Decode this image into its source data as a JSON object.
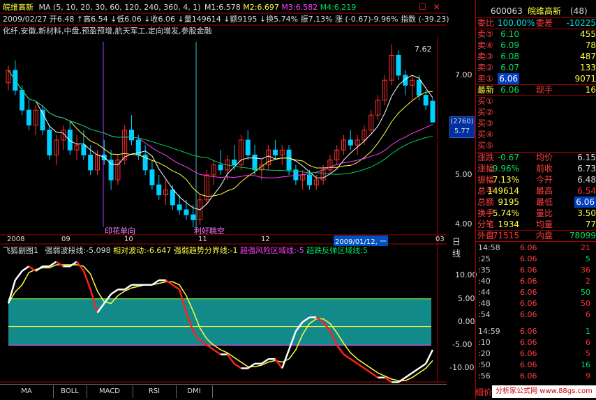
{
  "header": {
    "stock_name": "皖维高新",
    "ma_params": "MA (5, 10, 20, 30, 60, 120, 240, 360, 4, 1)",
    "m1": "M1:6.578",
    "m2": "M2:6.697",
    "m3": "M3:6.582",
    "m4": "M4:6.219",
    "close_icon": "✕",
    "restore_icon": "☐",
    "quote_line": "2009/02/27  开6.48  ↑高6.54  ↓低6.06  ↓收6.06  ↓量149614  ↓额9195  ↓换5.74%  振7.13%  涨 (-0.67)-9.96%  指数 (-39.23)",
    "concepts": "化纤,安徽,新材料,中盘,预盈预增,航天军工,定向增发,参股金融"
  },
  "price_chart": {
    "price_labels": [
      "7.00",
      "6.00",
      "5.00",
      "4.00"
    ],
    "peak_label": "7.62",
    "current_box_top": "(2760)",
    "current_box_bottom": "5.77",
    "annotation_left": "印花单向",
    "annotation_right": "利好眺空",
    "date_labels": [
      "2008",
      "09",
      "10",
      "11",
      "12",
      "2009/01/12, 一",
      "03"
    ],
    "period": "日线",
    "candles": [
      [
        6.85,
        7.2,
        6.7,
        7.1
      ],
      [
        7.1,
        7.3,
        6.6,
        6.7
      ],
      [
        6.7,
        6.8,
        6.2,
        6.3
      ],
      [
        6.3,
        6.5,
        5.9,
        6.0
      ],
      [
        6.0,
        6.4,
        5.8,
        6.3
      ],
      [
        6.3,
        6.4,
        5.8,
        5.9
      ],
      [
        5.9,
        6.0,
        5.3,
        5.4
      ],
      [
        5.4,
        5.8,
        5.2,
        5.7
      ],
      [
        5.7,
        6.0,
        5.5,
        5.9
      ],
      [
        5.9,
        6.1,
        5.4,
        5.5
      ],
      [
        5.5,
        5.8,
        5.3,
        5.6
      ],
      [
        5.6,
        5.9,
        5.3,
        5.4
      ],
      [
        5.4,
        5.6,
        5.0,
        5.1
      ],
      [
        5.1,
        5.5,
        5.0,
        5.4
      ],
      [
        5.4,
        5.7,
        5.2,
        5.3
      ],
      [
        5.3,
        5.5,
        4.7,
        4.9
      ],
      [
        4.9,
        5.4,
        4.8,
        5.3
      ],
      [
        5.3,
        6.0,
        5.2,
        5.9
      ],
      [
        5.9,
        6.2,
        5.6,
        5.7
      ],
      [
        5.7,
        5.8,
        5.3,
        5.4
      ],
      [
        5.4,
        5.6,
        5.0,
        5.1
      ],
      [
        5.1,
        5.3,
        4.7,
        4.8
      ],
      [
        4.8,
        5.0,
        4.5,
        4.6
      ],
      [
        4.6,
        4.9,
        4.4,
        4.7
      ],
      [
        4.7,
        4.8,
        4.3,
        4.4
      ],
      [
        4.4,
        4.6,
        4.2,
        4.3
      ],
      [
        4.3,
        4.5,
        4.1,
        4.2
      ],
      [
        4.2,
        4.4,
        3.95,
        4.1
      ],
      [
        4.1,
        4.6,
        4.0,
        4.5
      ],
      [
        4.5,
        5.1,
        4.4,
        5.0
      ],
      [
        5.0,
        5.3,
        4.8,
        5.2
      ],
      [
        5.2,
        5.5,
        5.0,
        5.1
      ],
      [
        5.1,
        5.4,
        4.9,
        5.3
      ],
      [
        5.3,
        5.6,
        5.1,
        5.2
      ],
      [
        5.2,
        5.8,
        5.1,
        5.7
      ],
      [
        5.7,
        5.9,
        5.3,
        5.4
      ],
      [
        5.4,
        5.6,
        5.0,
        5.1
      ],
      [
        5.1,
        5.3,
        4.9,
        5.2
      ],
      [
        5.2,
        5.6,
        5.1,
        5.5
      ],
      [
        5.5,
        5.7,
        5.3,
        5.4
      ],
      [
        5.4,
        5.6,
        5.2,
        5.5
      ],
      [
        5.5,
        5.6,
        5.0,
        5.1
      ],
      [
        5.1,
        5.2,
        4.8,
        4.9
      ],
      [
        4.9,
        5.1,
        4.7,
        5.0
      ],
      [
        5.0,
        5.1,
        4.7,
        4.8
      ],
      [
        4.8,
        5.0,
        4.7,
        4.9
      ],
      [
        4.9,
        5.2,
        4.8,
        5.1
      ],
      [
        5.1,
        5.4,
        5.0,
        5.3
      ],
      [
        5.3,
        5.6,
        5.2,
        5.5
      ],
      [
        5.5,
        5.8,
        5.4,
        5.7
      ],
      [
        5.7,
        5.9,
        5.5,
        5.6
      ],
      [
        5.6,
        5.8,
        5.4,
        5.7
      ],
      [
        5.7,
        6.0,
        5.6,
        5.9
      ],
      [
        5.9,
        6.3,
        5.8,
        6.2
      ],
      [
        6.2,
        6.6,
        6.1,
        6.5
      ],
      [
        6.5,
        7.0,
        6.4,
        6.9
      ],
      [
        6.9,
        7.62,
        6.8,
        7.4
      ],
      [
        7.4,
        7.5,
        6.9,
        7.0
      ],
      [
        7.0,
        7.1,
        6.6,
        6.8
      ],
      [
        6.8,
        7.0,
        6.5,
        6.9
      ],
      [
        6.9,
        7.0,
        6.5,
        6.6
      ],
      [
        6.6,
        6.7,
        6.3,
        6.4
      ],
      [
        6.48,
        6.54,
        6.06,
        6.06
      ]
    ]
  },
  "indicator": {
    "title": "飞狐副图1",
    "line1": "强弱波段线:-5.098",
    "line2": "相对波动:-6.647",
    "line3": "强弱趋势分界线:-1",
    "line4": "超强风险区域线:-5",
    "line5": "超跌反弹区域线:5",
    "axis_labels": [
      "10.00",
      "5.00",
      "0.00",
      "-5.00",
      "-10.00"
    ],
    "values": [
      4,
      9,
      11,
      12,
      11,
      12,
      12,
      13,
      12,
      12,
      13,
      11,
      7,
      2,
      4,
      6,
      7,
      7,
      8,
      8,
      8,
      8,
      9,
      9,
      8,
      7,
      2,
      -2,
      -4,
      -5,
      -6,
      -7,
      -7,
      -9,
      -10,
      -10,
      -9,
      -9,
      -8,
      -8,
      -10,
      -6,
      -2,
      0,
      1,
      1,
      0,
      -2,
      -5,
      -7,
      -8,
      -9,
      -10,
      -11,
      -12,
      -12,
      -13,
      -13,
      -12,
      -11,
      -10,
      -9,
      -6
    ],
    "ref_lines": [
      5,
      -1,
      -5
    ]
  },
  "tabs": [
    "MA",
    "BOLL",
    "MACD",
    "RSI",
    "DMI"
  ],
  "side": {
    "code": "600063",
    "name": "皖维高新",
    "count": "(48)",
    "weibi_label": "委比",
    "weibi_val": "100.00%",
    "weicha_label": "委差",
    "weicha_val": "-10225",
    "asks": [
      {
        "label": "卖⑤",
        "price": "6.10",
        "vol": "455"
      },
      {
        "label": "卖④",
        "price": "6.09",
        "vol": "78"
      },
      {
        "label": "卖③",
        "price": "6.08",
        "vol": "487"
      },
      {
        "label": "卖②",
        "price": "6.07",
        "vol": "133"
      },
      {
        "label": "卖①",
        "price": "6.06",
        "vol": "9071"
      }
    ],
    "latest_label": "最新",
    "latest_val": "6.06",
    "xianshou_label": "现手",
    "xianshou_val": "16",
    "bids": [
      "买①",
      "买②",
      "买③",
      "买④",
      "买⑤"
    ],
    "stats": [
      {
        "l1": "涨跌",
        "v1": "-0.67",
        "l2": "均价",
        "v2": "6.15"
      },
      {
        "l1": "涨幅",
        "v1": "-9.96%",
        "l2": "前收",
        "v2": "6.73"
      },
      {
        "l1": "振幅",
        "v1": "7.13%",
        "l2": "今开",
        "v2": "6.48"
      },
      {
        "l1": "总手",
        "v1": "149614",
        "l2": "最高",
        "v2": "6.54"
      },
      {
        "l1": "总额",
        "v1": "9195",
        "l2": "最低",
        "v2": "6.06"
      },
      {
        "l1": "换手",
        "v1": "5.74%",
        "l2": "量比",
        "v2": "3.50"
      },
      {
        "l1": "分笔",
        "v1": "1934",
        "l2": "均量",
        "v2": "77"
      }
    ],
    "waipan_label": "外盘",
    "waipan_val": "71515",
    "neipan_label": "内盘",
    "neipan_val": "78099",
    "ticks": [
      {
        "t": "14:58",
        "p": "6.06",
        "v": "21"
      },
      {
        "t": ":25",
        "p": "6.06",
        "v": "5"
      },
      {
        "t": ":35",
        "p": "6.06",
        "v": "36"
      },
      {
        "t": ":40",
        "p": "6.06",
        "v": "2"
      },
      {
        "t": ":44",
        "p": "6.06",
        "v": "50"
      },
      {
        "t": ":48",
        "p": "6.06",
        "v": "50"
      },
      {
        "t": ":54",
        "p": "6.06",
        "v": "6"
      },
      {
        "t": "14:59",
        "p": "6.06",
        "v": "1"
      },
      {
        "t": ":10",
        "p": "6.06",
        "v": "6"
      },
      {
        "t": ":20",
        "p": "6.06",
        "v": "5"
      },
      {
        "t": ":50",
        "p": "6.06",
        "v": "16"
      },
      {
        "t": ":56",
        "p": "6.06",
        "v": "9"
      }
    ],
    "detail_label": "细价",
    "watermark": "分析家公式网 www.88gs.com"
  }
}
